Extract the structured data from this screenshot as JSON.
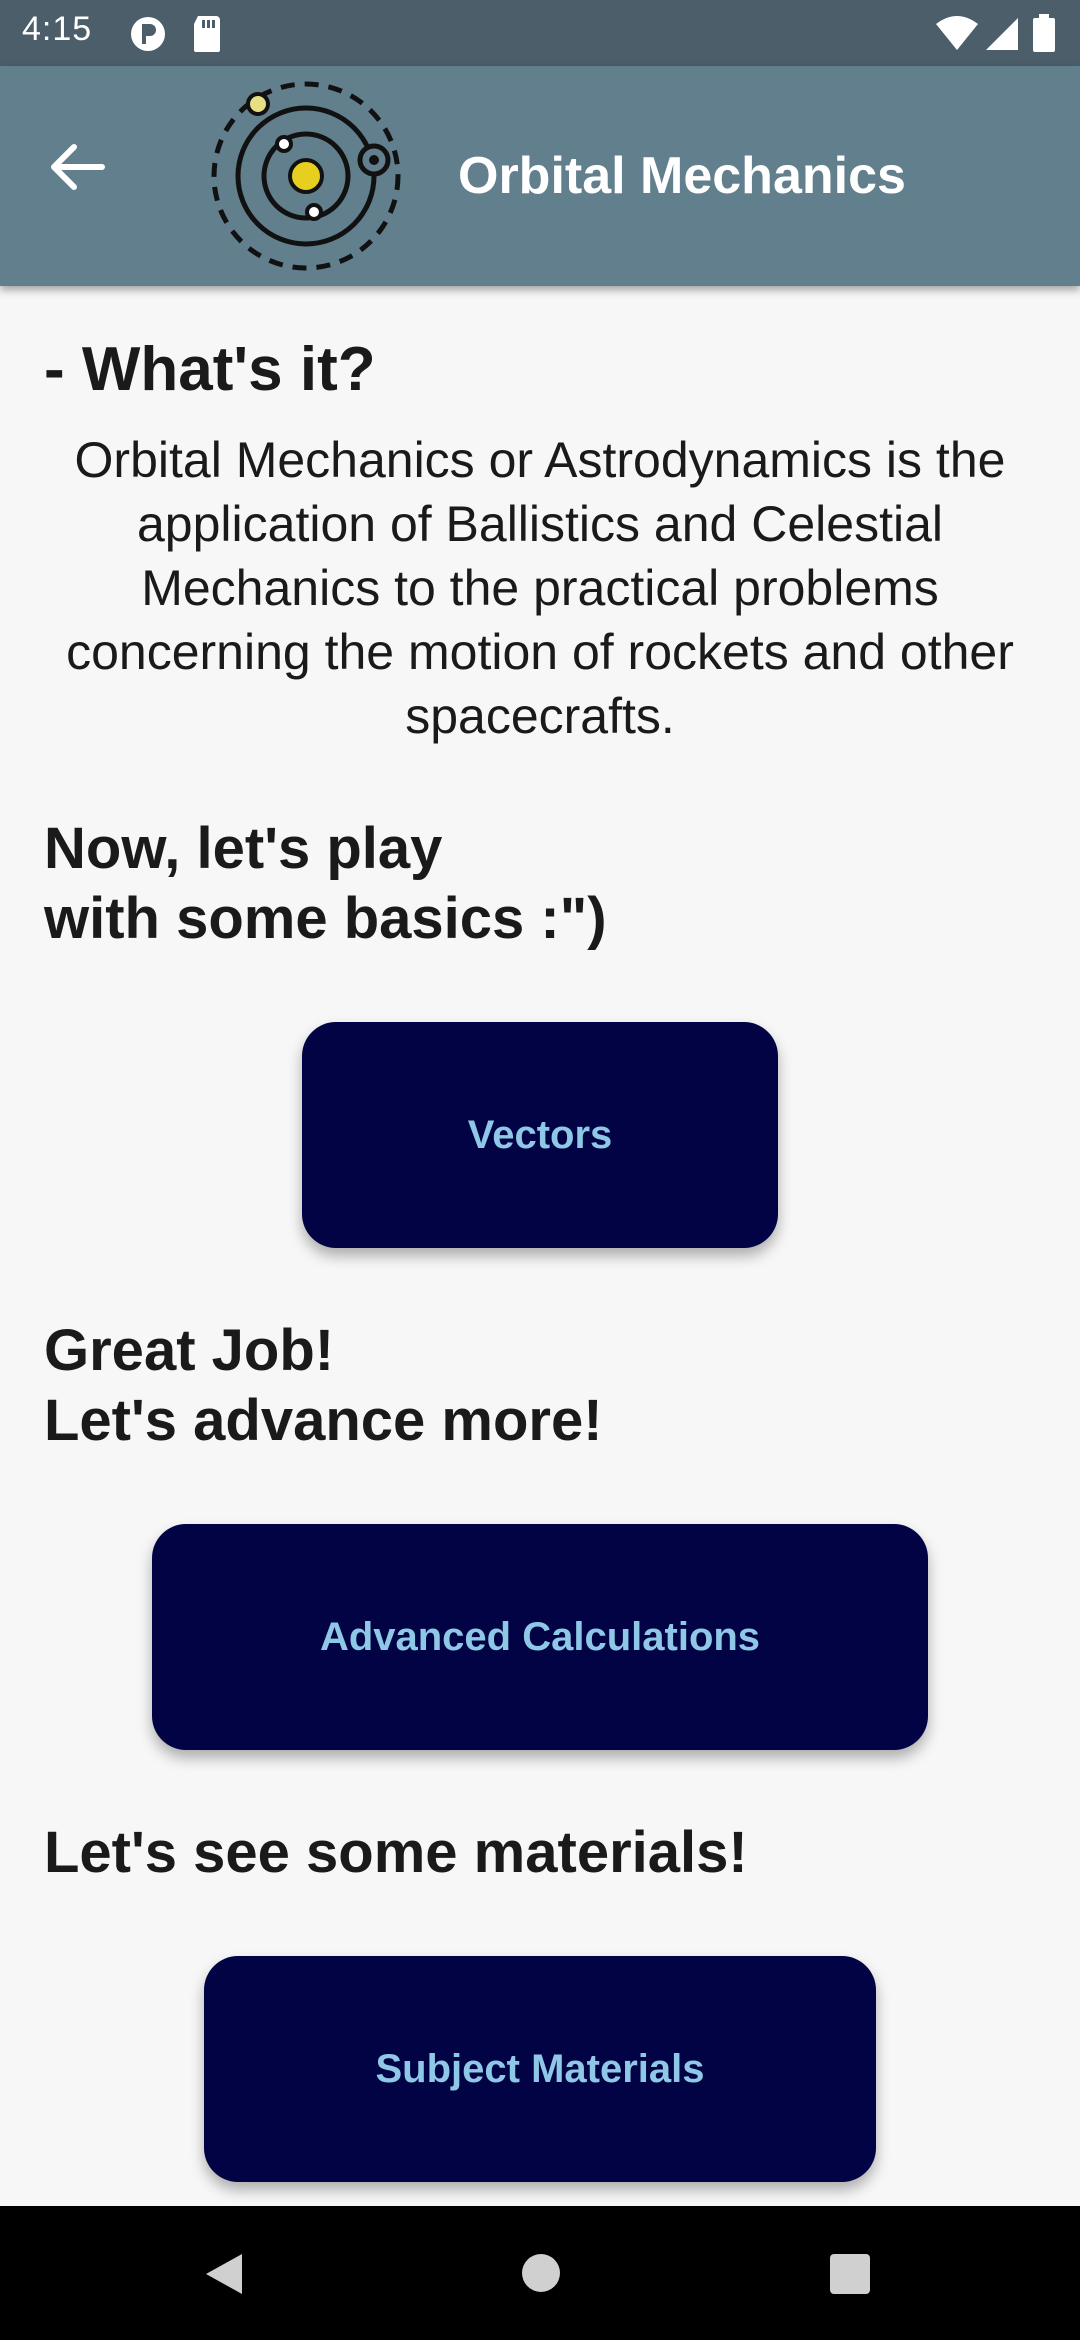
{
  "status_bar": {
    "time": "4:15"
  },
  "app_bar": {
    "title": "Orbital Mechanics"
  },
  "main": {
    "section_title": "- What's it?",
    "description": "Orbital Mechanics or Astrodynamics is the application of Ballistics and Celestial Mechanics to the practical problems concerning the motion of rockets and other spacecrafts.",
    "prompt_basics": "Now, let's play\nwith some basics :\")",
    "vectors_button": "Vectors",
    "prompt_advance": "Great Job!\nLet's advance more!",
    "advanced_button": "Advanced Calculations",
    "prompt_materials": "Let's see some materials!",
    "materials_button": "Subject Materials"
  },
  "colors": {
    "app_bar": "#627f8d",
    "status_bar": "#4b5e6a",
    "button_bg": "#020344",
    "button_text": "#8ec8e6"
  }
}
